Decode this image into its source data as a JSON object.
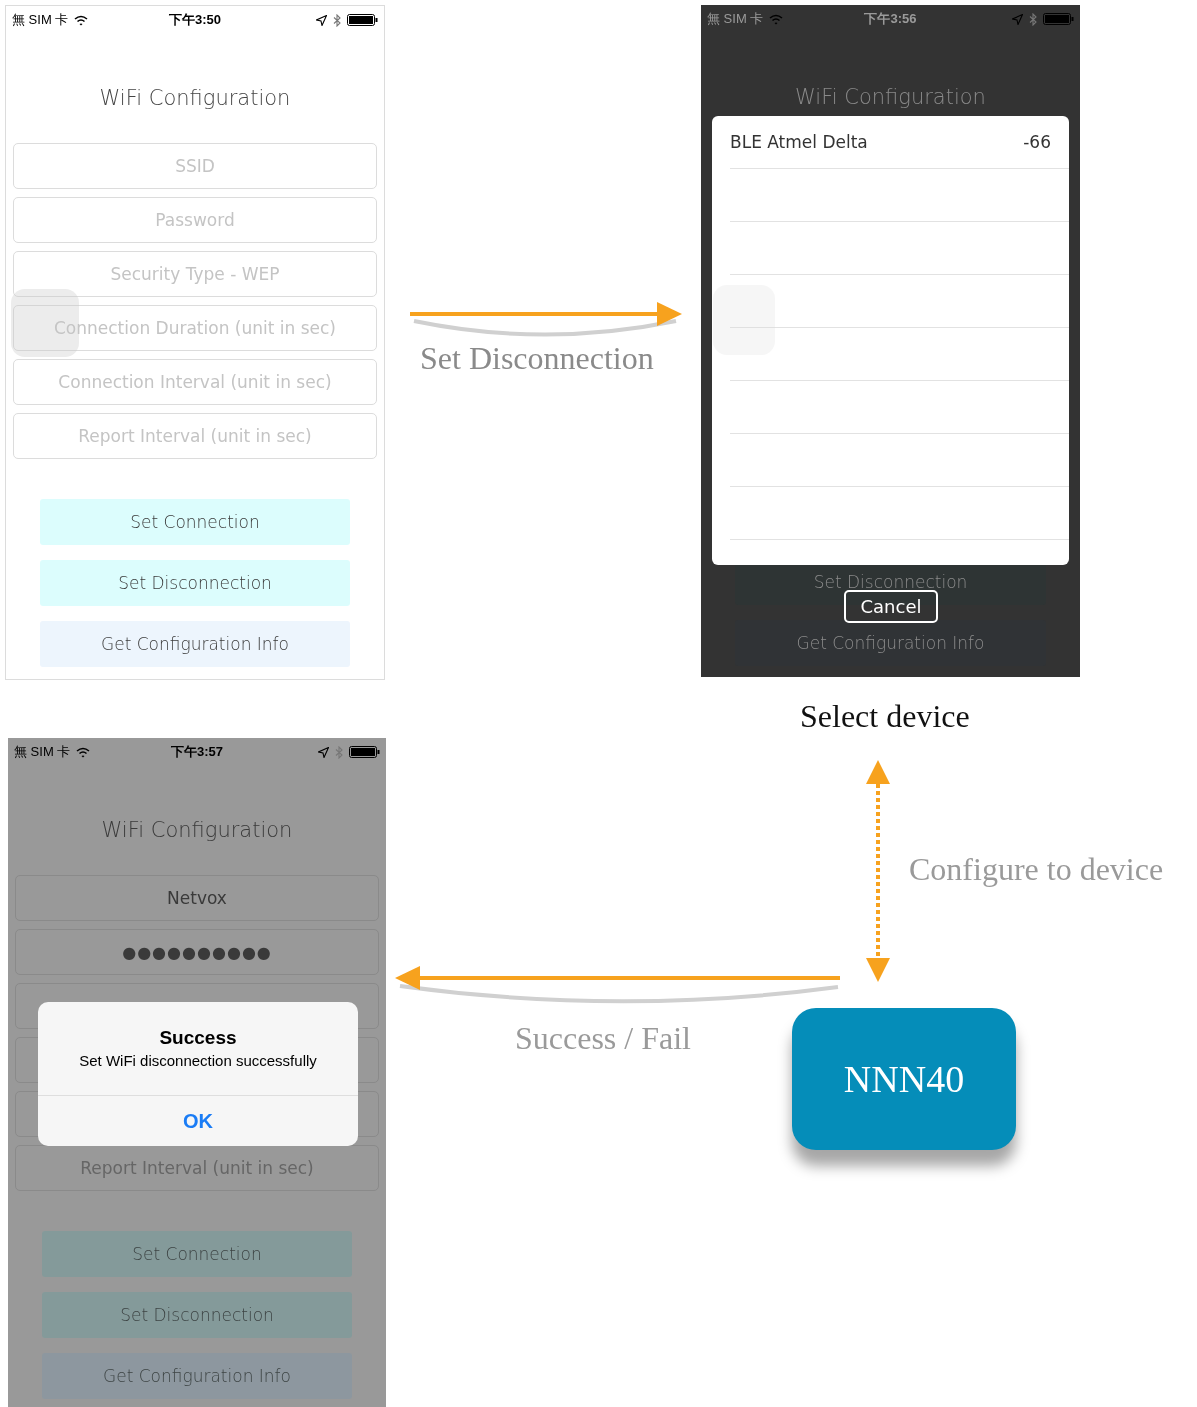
{
  "screens": [
    {
      "kind": "form",
      "dimmed": false,
      "status_bar": {
        "carrier": "無 SIM 卡",
        "time": "下午3:50"
      },
      "title": "WiFi Configuration",
      "fields": [
        {
          "placeholder": "SSID",
          "obscured": false
        },
        {
          "placeholder": "Password",
          "obscured": false
        },
        {
          "placeholder": "Security Type - WEP",
          "obscured": false
        },
        {
          "placeholder": "Connection Duration (unit in sec)",
          "obscured": false
        },
        {
          "placeholder": "Connection Interval (unit in sec)",
          "obscured": false
        },
        {
          "placeholder": "Report Interval (unit in sec)",
          "obscured": false
        }
      ],
      "buttons": [
        {
          "label": "Set Connection",
          "color": "#dcfdfd"
        },
        {
          "label": "Set Disconnection",
          "color": "#dcfdfd"
        },
        {
          "label": "Get Configuration Info",
          "color": "#edf5fd"
        }
      ]
    },
    {
      "kind": "picker",
      "dimmed": true,
      "status_bar": {
        "carrier": "無 SIM 卡",
        "time": "下午3:56"
      },
      "title": "WiFi Configuration",
      "buttons": [
        {
          "label": "Set Disconnection",
          "color": "#2e3434"
        },
        {
          "label": "Get Configuration Info",
          "color": "#303336"
        }
      ],
      "device_list": {
        "devices": [
          {
            "name": "BLE Atmel Delta",
            "rssi": "-66"
          }
        ]
      },
      "cancel": "Cancel"
    },
    {
      "kind": "alert",
      "dimmed": true,
      "status_bar": {
        "carrier": "無 SIM 卡",
        "time": "下午3:57"
      },
      "title": "WiFi Configuration",
      "fields": [
        {
          "value": "Netvox",
          "obscured": false
        },
        {
          "value": "●●●●●●●●●●",
          "obscured": false
        },
        {
          "obscured": true
        },
        {
          "obscured": true
        },
        {
          "obscured": true
        },
        {
          "placeholder": "Report Interval (unit in sec)",
          "obscured": false
        }
      ],
      "buttons": [
        {
          "label": "Set Connection",
          "color": "#849a9a"
        },
        {
          "label": "Set Disconnection",
          "color": "#849a9a"
        },
        {
          "label": "Get Configuration Info",
          "color": "#8d979f"
        }
      ],
      "alert": {
        "title": "Success",
        "message": "Set WiFi disconnection successfully",
        "button": "OK"
      }
    }
  ],
  "diagram": {
    "labels": [
      "Set Disconnection",
      "Select device",
      "Configure to device",
      "Success / Fail"
    ],
    "device": "NNN40"
  }
}
